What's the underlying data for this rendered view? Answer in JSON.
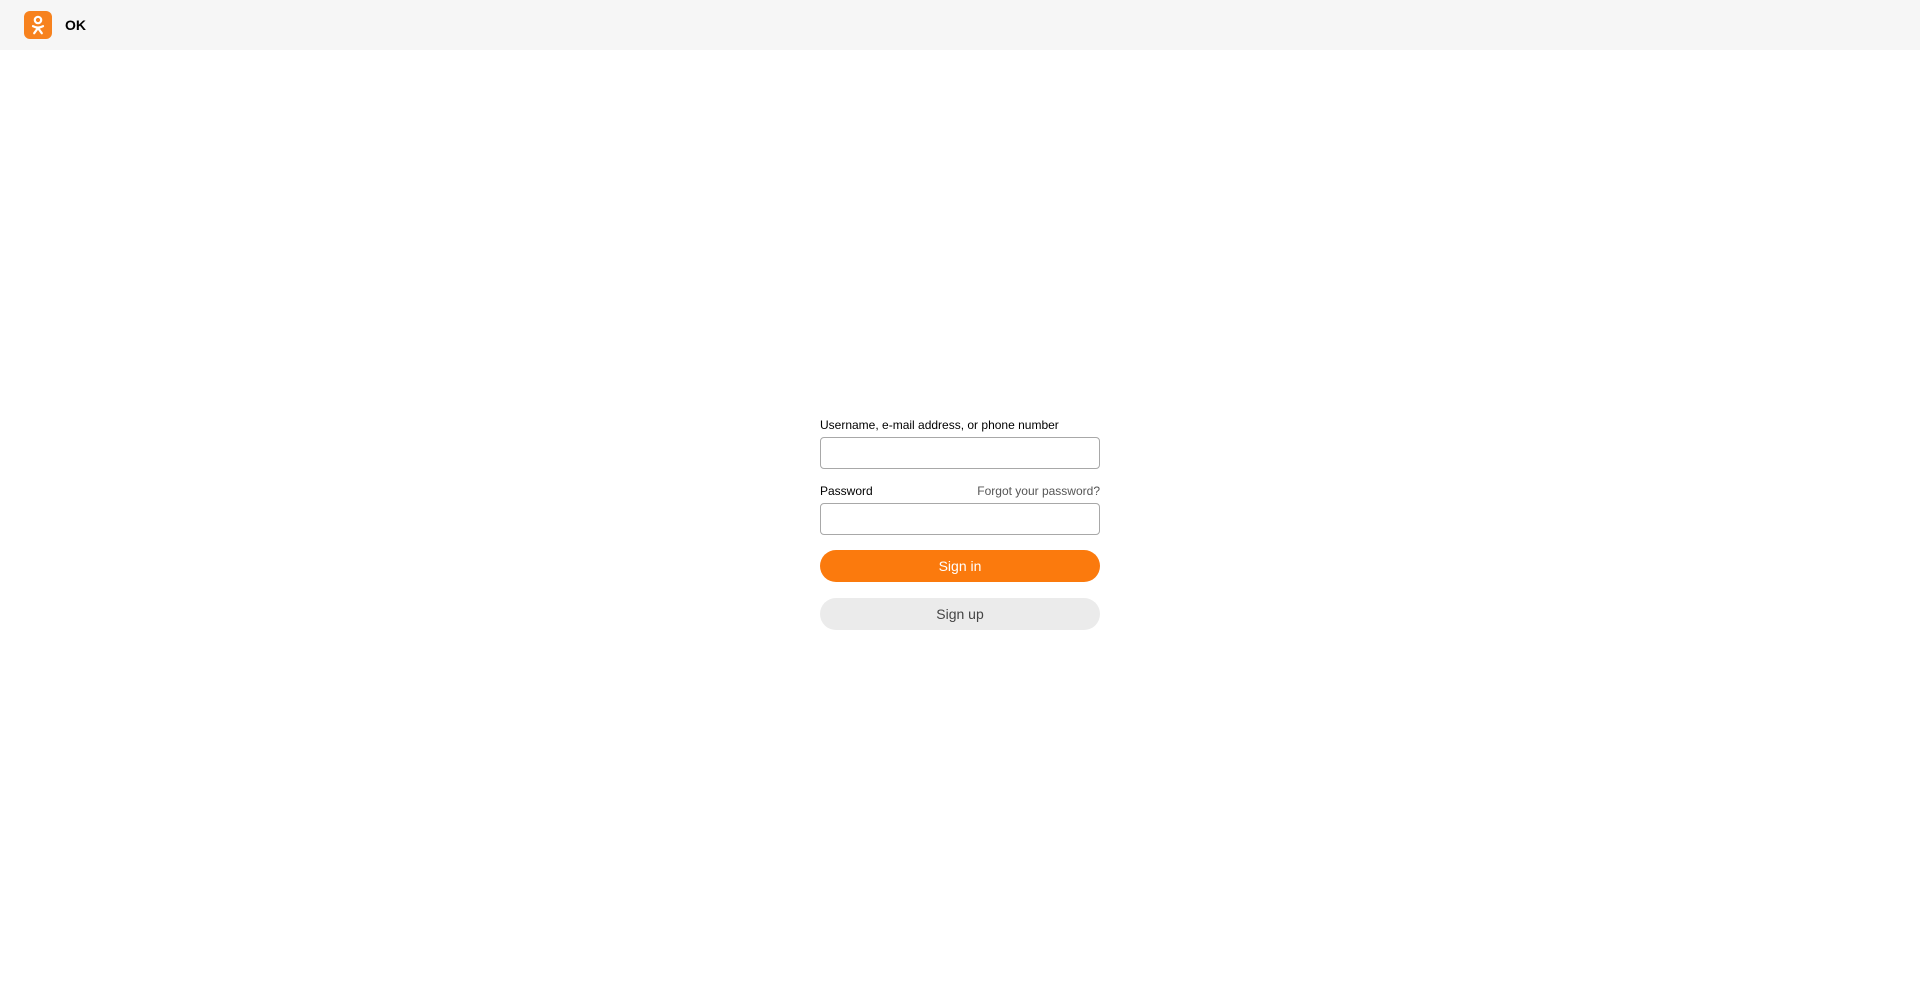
{
  "header": {
    "brand": "OK",
    "logo_icon": "odnoklassniki-logo-icon",
    "accent_color": "#f7821e"
  },
  "login": {
    "login_label": "Username, e-mail address, or phone number",
    "login_value": "",
    "password_label": "Password",
    "password_value": "",
    "forgot_link": "Forgot your password?",
    "sign_in_button": "Sign in",
    "sign_up_button": "Sign up",
    "primary_color": "#fb7a0d",
    "secondary_color": "#ebebeb"
  }
}
